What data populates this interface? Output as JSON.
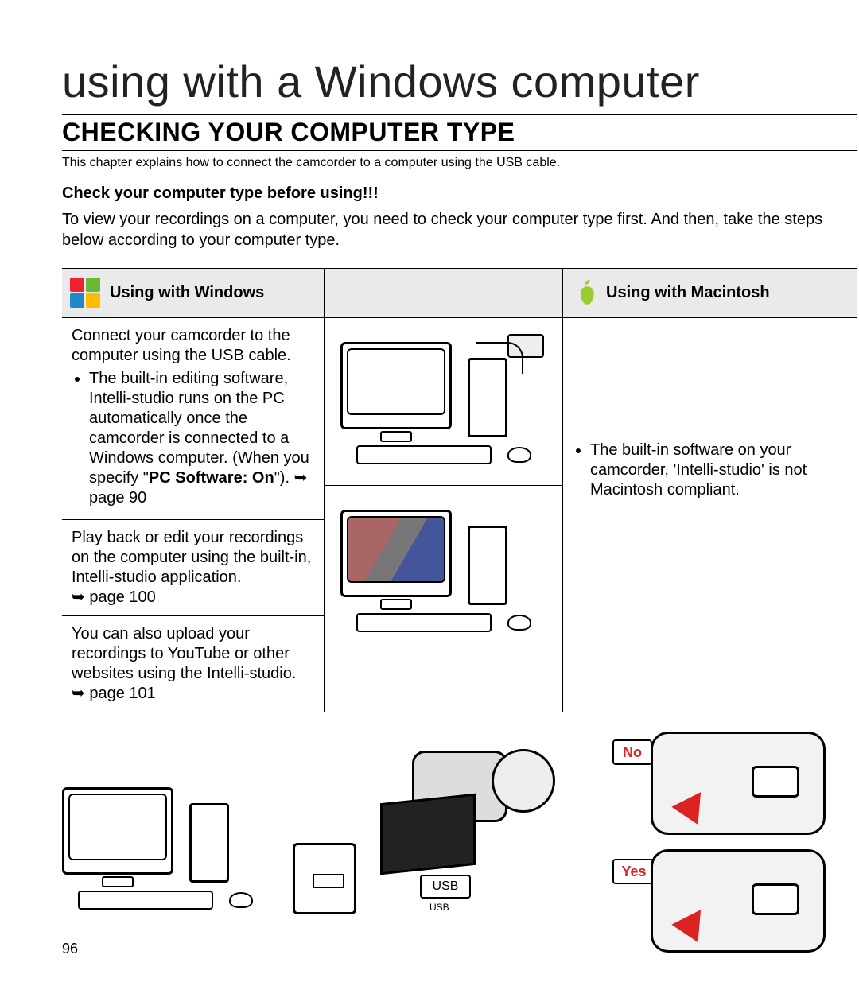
{
  "page_number": "96",
  "chapter_title": "using with a Windows computer",
  "section_title": "CHECKING YOUR COMPUTER TYPE",
  "intro": "This chapter explains how to connect the camcorder to a computer using the USB cable.",
  "subhead": "Check your computer type before using!!!",
  "body": "To view your recordings on a computer, you need to check your computer type first. And then, take the steps below according to your computer type.",
  "windows": {
    "header": "Using with Windows",
    "row1_lead": "Connect your camcorder to the computer using the USB cable.",
    "row1_bullet_a": "The built-in editing software, Intelli-studio runs on the PC automatically once the camcorder is connected to a Windows computer. (When you specify \"",
    "row1_bullet_bold": "PC Software: On",
    "row1_bullet_b": "\"). ",
    "row1_pageref": "page 90",
    "row2": "Play back or edit your recordings on the computer using the built-in, Intelli-studio application.",
    "row2_pageref": "page 100",
    "row3": "You can also upload your recordings to YouTube or other websites using the Intelli-studio.",
    "row3_pageref": "page 101"
  },
  "mac": {
    "header": "Using with Macintosh",
    "bullet": "The built-in software on your camcorder, 'Intelli-studio' is not Macintosh compliant."
  },
  "labels": {
    "usb": "USB",
    "usb_small": "USB",
    "no": "No",
    "yes": "Yes",
    "arrow": "➥"
  }
}
